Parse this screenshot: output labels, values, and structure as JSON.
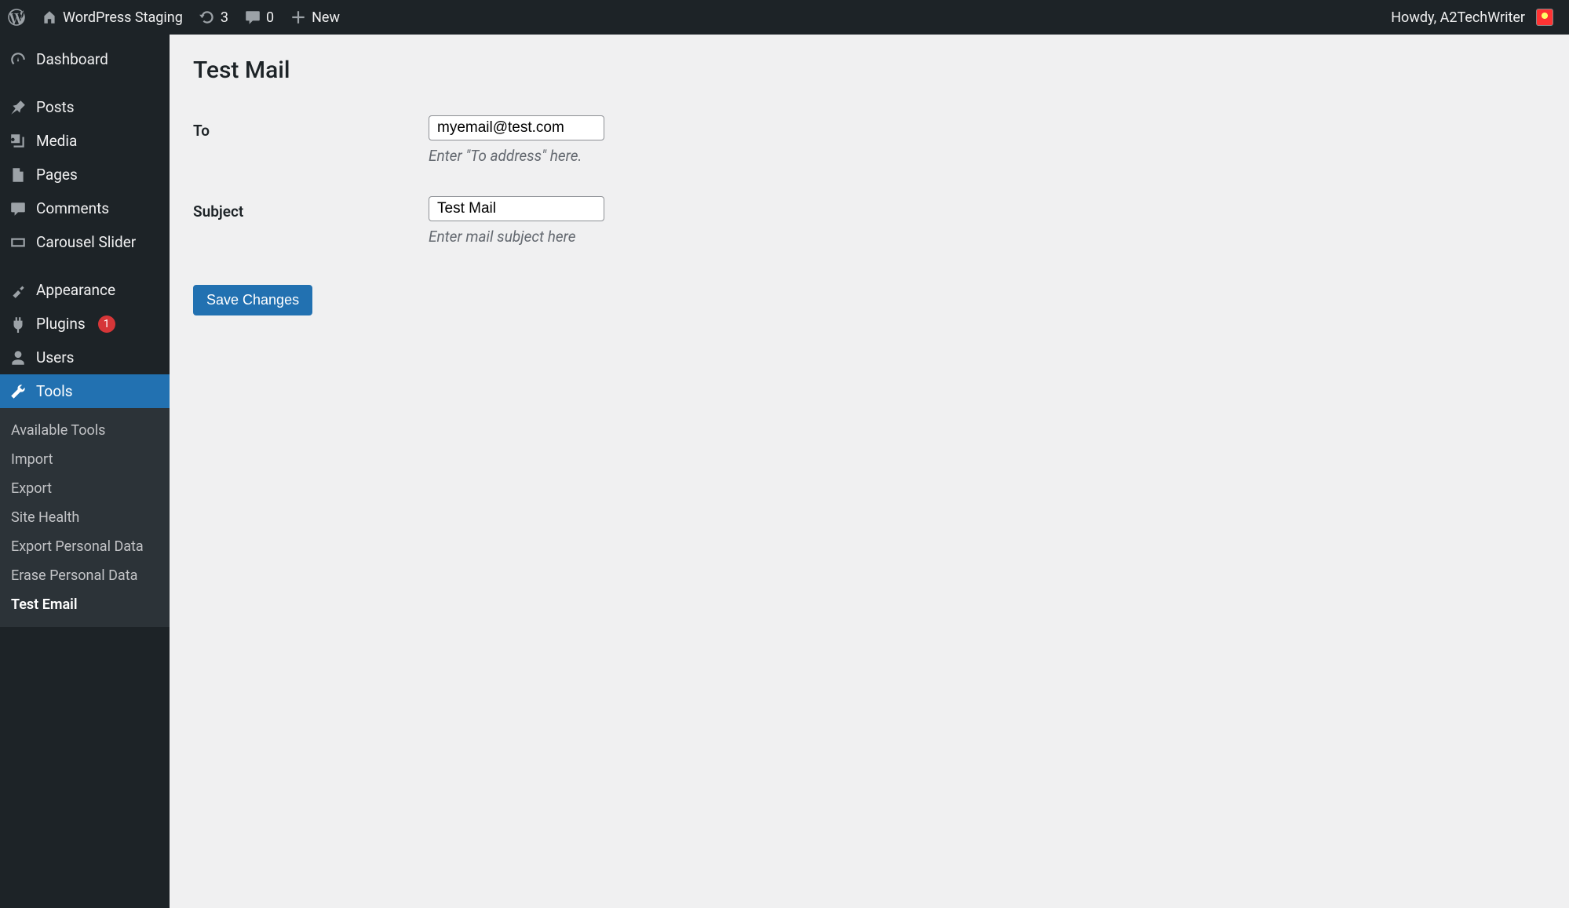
{
  "adminbar": {
    "site_name": "WordPress Staging",
    "updates_count": "3",
    "comments_count": "0",
    "new_label": "New",
    "howdy": "Howdy, A2TechWriter"
  },
  "sidebar": {
    "items": [
      {
        "label": "Dashboard"
      },
      {
        "label": "Posts"
      },
      {
        "label": "Media"
      },
      {
        "label": "Pages"
      },
      {
        "label": "Comments"
      },
      {
        "label": "Carousel Slider"
      },
      {
        "label": "Appearance"
      },
      {
        "label": "Plugins",
        "badge": "1"
      },
      {
        "label": "Users"
      },
      {
        "label": "Tools"
      }
    ],
    "submenu": [
      {
        "label": "Available Tools"
      },
      {
        "label": "Import"
      },
      {
        "label": "Export"
      },
      {
        "label": "Site Health"
      },
      {
        "label": "Export Personal Data"
      },
      {
        "label": "Erase Personal Data"
      },
      {
        "label": "Test Email"
      }
    ]
  },
  "page": {
    "title": "Test Mail",
    "to_label": "To",
    "to_value": "myemail@test.com",
    "to_description": "Enter \"To address\" here.",
    "subject_label": "Subject",
    "subject_value": "Test Mail",
    "subject_description": "Enter mail subject here",
    "save_label": "Save Changes"
  }
}
